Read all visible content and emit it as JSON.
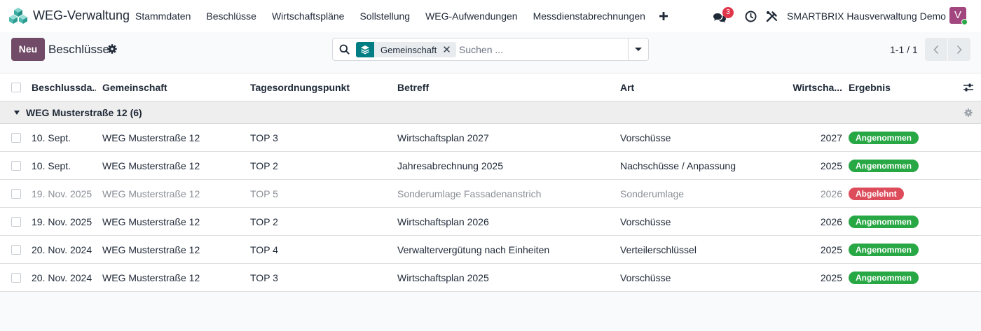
{
  "app": {
    "name": "WEG-Verwaltung",
    "logo_icon": "cube-stack-logo-icon"
  },
  "menu": [
    "Stammdaten",
    "Beschlüsse",
    "Wirtschaftspläne",
    "Sollstellung",
    "WEG-Aufwendungen",
    "Messdienstabrechnungen"
  ],
  "menu_add_icon": "plus-icon",
  "systray": {
    "chat_icon": "chat-icon",
    "chat_count": "3",
    "clock_icon": "clock-icon",
    "tools_icon": "tools-icon",
    "company": "SMARTBRIX Hausverwaltung Demo",
    "avatar_letter": "V"
  },
  "control": {
    "new_label": "Neu",
    "title": "Beschlüsse",
    "title_icon": "gear-icon"
  },
  "search": {
    "facet_icon": "layers-icon",
    "facet_label": "Gemeinschaft",
    "facet_close": "✕",
    "placeholder": "Suchen ...",
    "value": "",
    "toggle_icon": "caret-down-icon"
  },
  "pager": {
    "value": "1-1 / 1"
  },
  "table": {
    "columns": [
      "Beschlussda...",
      "Gemeinschaft",
      "Tagesordnungspunkt",
      "Betreff",
      "Art",
      "Wirtscha...",
      "Ergebnis"
    ],
    "settings_icon": "sliders-icon",
    "group": {
      "label": "WEG Musterstraße 12 (6)",
      "settings_icon": "gear-icon"
    },
    "rows": [
      {
        "date": "10. Sept.",
        "community": "WEG Musterstraße 12",
        "top": "TOP 3",
        "subject": "Wirtschaftsplan 2027",
        "type": "Vorschüsse",
        "year": "2027",
        "result": "Angenommen",
        "muted": false
      },
      {
        "date": "10. Sept.",
        "community": "WEG Musterstraße 12",
        "top": "TOP 2",
        "subject": "Jahresabrechnung 2025",
        "type": "Nachschüsse / Anpassung",
        "year": "2025",
        "result": "Angenommen",
        "muted": false
      },
      {
        "date": "19. Nov. 2025",
        "community": "WEG Musterstraße 12",
        "top": "TOP 5",
        "subject": "Sonderumlage Fassadenanstrich",
        "type": "Sonderumlage",
        "year": "2026",
        "result": "Abgelehnt",
        "muted": true
      },
      {
        "date": "19. Nov. 2025",
        "community": "WEG Musterstraße 12",
        "top": "TOP 2",
        "subject": "Wirtschaftsplan 2026",
        "type": "Vorschüsse",
        "year": "2026",
        "result": "Angenommen",
        "muted": false
      },
      {
        "date": "20. Nov. 2024",
        "community": "WEG Musterstraße 12",
        "top": "TOP 4",
        "subject": "Verwaltervergütung nach Einheiten",
        "type": "Verteilerschlüssel",
        "year": "2025",
        "result": "Angenommen",
        "muted": false
      },
      {
        "date": "20. Nov. 2024",
        "community": "WEG Musterstraße 12",
        "top": "TOP 3",
        "subject": "Wirtschaftsplan 2025",
        "type": "Vorschüsse",
        "year": "2025",
        "result": "Angenommen",
        "muted": false
      }
    ]
  },
  "colors": {
    "brand": "#714b67",
    "accepted": "#28a745",
    "rejected": "#dc4c5a",
    "facet_icon_bg": "#017e84",
    "chat_badge": "#e0364b",
    "avatar_bg": "#a2467f"
  }
}
